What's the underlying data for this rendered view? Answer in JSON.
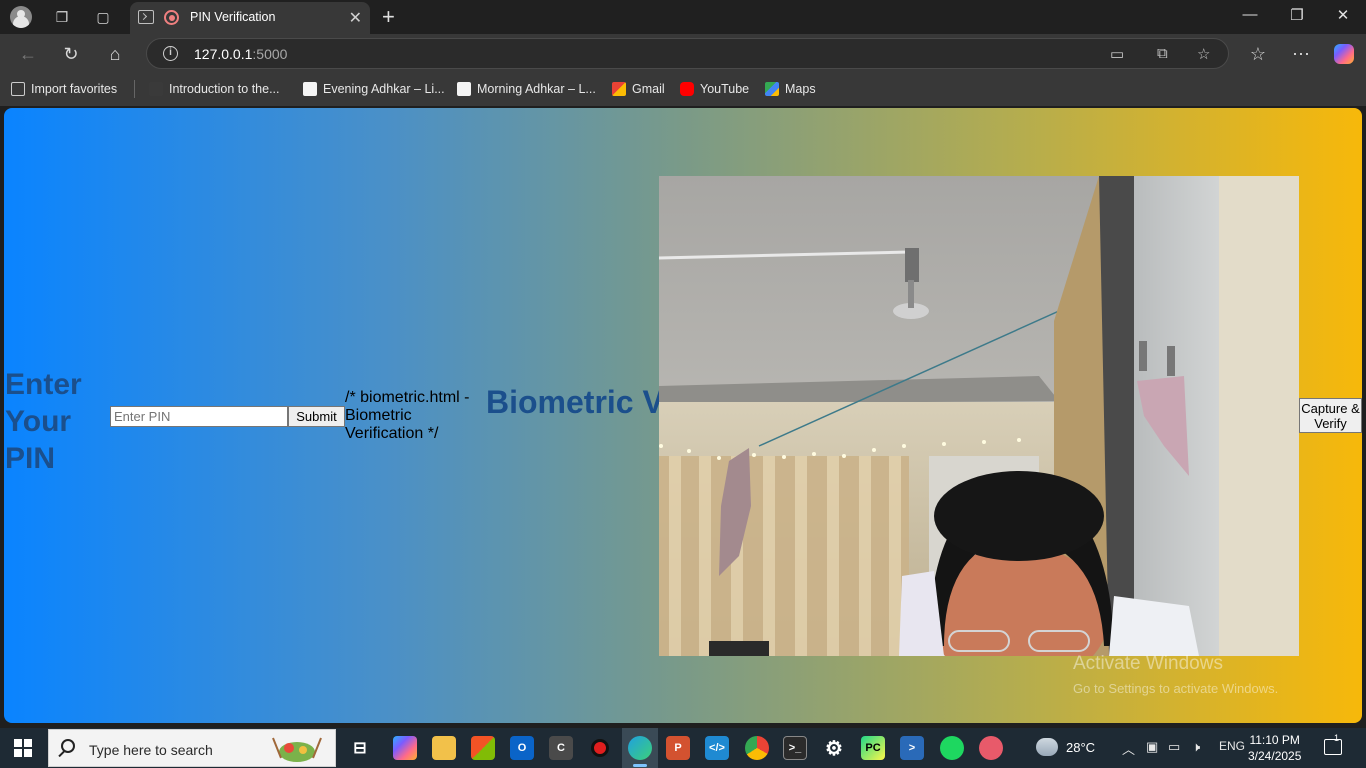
{
  "browser": {
    "tab_title": "PIN Verification",
    "url_host": "127.0.0.1",
    "url_port": ":5000",
    "favorites": [
      {
        "label": "Import favorites"
      },
      {
        "label": "Introduction to the..."
      },
      {
        "label": "Evening Adhkar – Li..."
      },
      {
        "label": "Morning Adhkar – L..."
      },
      {
        "label": "Gmail"
      },
      {
        "label": "YouTube"
      },
      {
        "label": "Maps"
      }
    ]
  },
  "page": {
    "pin_heading": "Enter Your PIN",
    "pin_placeholder": "Enter PIN",
    "pin_value": "",
    "submit_label": "Submit",
    "comment_text": "/* biometric.html - Biometric Verification */",
    "bio_heading": "Biometric Verification",
    "capture_label": "Capture & Verify",
    "activate_title": "Activate Windows",
    "activate_sub": "Go to Settings to activate Windows."
  },
  "taskbar": {
    "search_placeholder": "Type here to search",
    "weather_temp": "28°C",
    "language": "ENG",
    "time": "11:10 PM",
    "date": "3/24/2025",
    "notification_count": "1"
  },
  "colors": {
    "gradient_start": "#0a84ff",
    "gradient_end": "#f7b80a",
    "heading": "#1b4f8c"
  }
}
